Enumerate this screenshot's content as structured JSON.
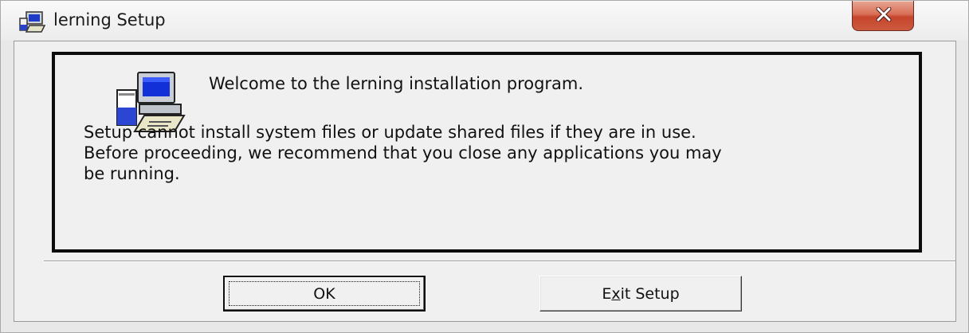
{
  "window": {
    "title": "lerning Setup",
    "icon": "setup-computer-icon",
    "close_icon": "close-x-icon",
    "close_color": "#c5452c"
  },
  "content": {
    "welcome": "Welcome to the lerning installation program.",
    "body_lines": [
      "Setup cannot install system files or update shared files if they are in use.",
      "Before proceeding, we recommend that you close any applications you may",
      "be running."
    ],
    "icon": "setup-computer-icon"
  },
  "buttons": {
    "ok_label": "OK",
    "exit_pre": "E",
    "exit_mnemonic": "x",
    "exit_post": "it Setup"
  }
}
